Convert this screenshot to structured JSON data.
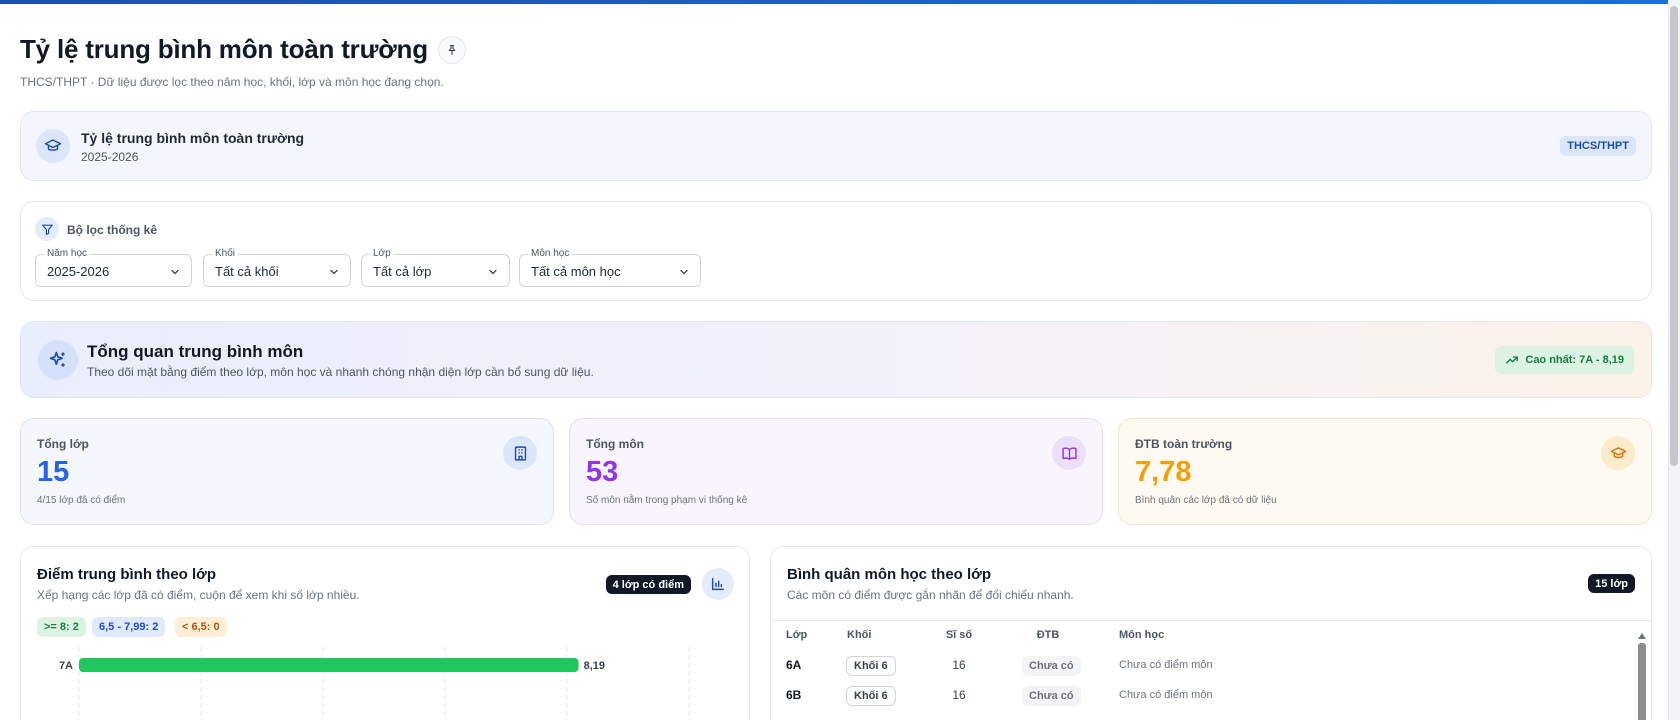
{
  "header": {
    "title": "Tỷ lệ trung bình môn toàn trường",
    "pin_icon": "pin-icon",
    "subtitle": "THCS/THPT · Dữ liệu được lọc theo năm học, khối, lớp và môn học đang chọn."
  },
  "school": {
    "icon": "graduation-cap-icon",
    "name": "Tỷ lệ trung bình môn toàn trường",
    "year": "2025-2026",
    "level_badge": "THCS/THPT"
  },
  "filters": {
    "icon": "filter-icon",
    "title": "Bộ lọc thống kê",
    "year": {
      "label": "Năm học",
      "value": "2025-2026"
    },
    "grade": {
      "label": "Khối",
      "value": "Tất cả khối"
    },
    "class": {
      "label": "Lớp",
      "value": "Tất cả lớp"
    },
    "subject": {
      "label": "Môn học",
      "value": "Tất cả môn học"
    }
  },
  "overview": {
    "icon": "sparkles-icon",
    "title": "Tổng quan trung bình môn",
    "description": "Theo dõi mặt bằng điểm theo lớp, môn học và nhanh chóng nhận diện lớp cần bổ sung dữ liệu.",
    "best_icon": "trending-up-icon",
    "best_label": "Cao nhất: 7A - 8,19"
  },
  "stats": {
    "classes": {
      "label": "Tổng lớp",
      "value": "15",
      "hint": "4/15 lớp đã có điểm",
      "icon": "building-icon",
      "color": "#2563eb"
    },
    "subjects": {
      "label": "Tổng môn",
      "value": "53",
      "hint": "Số môn nằm trong phạm vi thống kê",
      "icon": "book-open-icon",
      "color": "#9333ea"
    },
    "average": {
      "label": "ĐTB toàn trường",
      "value": "7,78",
      "hint": "Bình quân các lớp đã có dữ liệu",
      "icon": "graduation-cap-icon",
      "color": "#f59e0b"
    }
  },
  "bar_section": {
    "title": "Điểm trung bình theo lớp",
    "description": "Xếp hạng các lớp đã có điểm, cuộn để xem khi số lớp nhiều.",
    "count_badge": "4 lớp có điểm",
    "icon": "bar-chart-icon",
    "chips": {
      "high": ">= 8: 2",
      "mid": "6,5 - 7,99: 2",
      "low": "< 6,5: 0"
    }
  },
  "chart_data": {
    "type": "bar",
    "orientation": "horizontal",
    "categories": [
      "7A"
    ],
    "values": [
      8.19
    ],
    "value_labels": [
      "8,19"
    ],
    "xlim": [
      0,
      10
    ],
    "grid": true,
    "bar_color": "#22c55e"
  },
  "table_section": {
    "title": "Bình quân môn học theo lớp",
    "description": "Các môn có điểm được gắn nhãn để đối chiếu nhanh.",
    "count_badge": "15 lớp",
    "columns": [
      "Lớp",
      "Khối",
      "Sĩ số",
      "ĐTB",
      "Môn học"
    ],
    "rows": [
      {
        "class": "6A",
        "grade": "Khối 6",
        "size": "16",
        "avg": "Chưa có",
        "subjects": "Chưa có điểm môn"
      },
      {
        "class": "6B",
        "grade": "Khối 6",
        "size": "16",
        "avg": "Chưa có",
        "subjects": "Chưa có điểm môn"
      }
    ]
  }
}
